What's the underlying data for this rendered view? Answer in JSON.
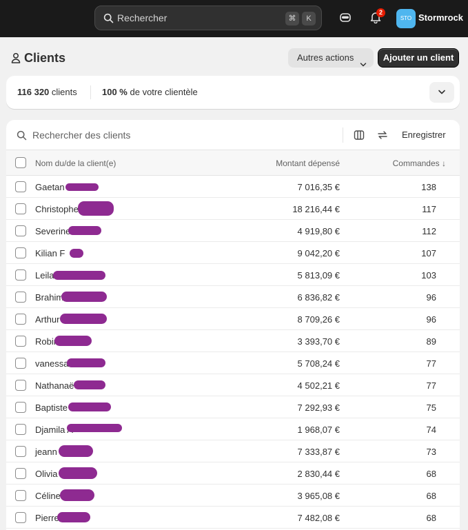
{
  "topbar": {
    "search_placeholder": "Rechercher",
    "shortcut_cmd": "⌘",
    "shortcut_key": "K",
    "notification_count": "2",
    "store_avatar": "STO",
    "store_name": "Stormrock"
  },
  "header": {
    "title": "Clients",
    "other_actions": "Autres actions",
    "add_client": "Ajouter un client"
  },
  "summary": {
    "count_value": "116 320",
    "count_label": "clients",
    "percent_value": "100 %",
    "percent_label": "de votre clientèle"
  },
  "filter": {
    "placeholder": "Rechercher des clients",
    "save_label": "Enregistrer"
  },
  "table": {
    "columns": {
      "name": "Nom du/de la client(e)",
      "amount": "Montant dépensé",
      "orders": "Commandes ↓"
    },
    "rows": [
      {
        "name": "Gaetan",
        "amount": "7 016,35 €",
        "orders": "138"
      },
      {
        "name": "Christophe",
        "amount": "18 216,44 €",
        "orders": "117"
      },
      {
        "name": "Severine",
        "amount": "4 919,80 €",
        "orders": "112"
      },
      {
        "name": "Kilian F",
        "amount": "9 042,20 €",
        "orders": "107"
      },
      {
        "name": "Leila",
        "amount": "5 813,09 €",
        "orders": "103"
      },
      {
        "name": "Brahim",
        "amount": "6 836,82 €",
        "orders": "96"
      },
      {
        "name": "Arthur",
        "amount": "8 709,26 €",
        "orders": "96"
      },
      {
        "name": "Robin",
        "amount": "3 393,70 €",
        "orders": "89"
      },
      {
        "name": "vanessa",
        "amount": "5 708,24 €",
        "orders": "77"
      },
      {
        "name": "Nathanaë",
        "amount": "4 502,21 €",
        "orders": "77"
      },
      {
        "name": "Baptiste",
        "amount": "7 292,93 €",
        "orders": "75"
      },
      {
        "name": "Djamila A",
        "amount": "1 968,07 €",
        "orders": "74"
      },
      {
        "name": "jeann",
        "amount": "7 333,87 €",
        "orders": "73"
      },
      {
        "name": "Olivia",
        "amount": "2 830,44 €",
        "orders": "68"
      },
      {
        "name": "Céline",
        "amount": "3 965,08 €",
        "orders": "68"
      },
      {
        "name": "Pierre",
        "amount": "7 482,08 €",
        "orders": "68"
      }
    ]
  },
  "colors": {
    "topbar_bg": "#1a1a1a",
    "page_bg": "#f1f1f1",
    "primary_button": "#303030",
    "redaction": "#8e2a91",
    "store_avatar_bg": "#4fb6ef",
    "badge": "#e51c00"
  }
}
